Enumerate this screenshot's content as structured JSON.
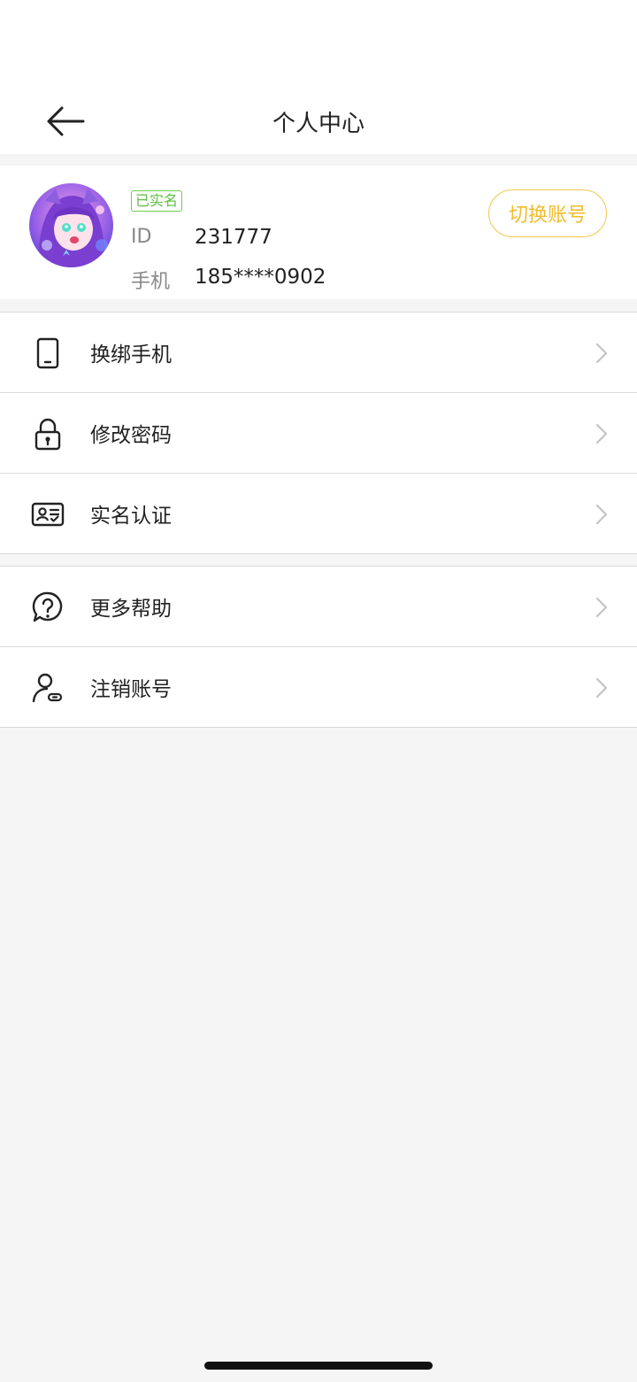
{
  "header": {
    "title": "个人中心",
    "back_icon": "arrow-left-icon"
  },
  "profile": {
    "verified_badge": "已实名",
    "id_label": "ID",
    "id_value": "231777",
    "phone_label": "手机",
    "phone_value": "185****0902",
    "switch_account_label": "切换账号",
    "accent_color": "#f0bc2a",
    "verified_color": "#5cbf3e"
  },
  "menu_group_1": [
    {
      "label": "换绑手机",
      "icon": "phone-icon"
    },
    {
      "label": "修改密码",
      "icon": "lock-icon"
    },
    {
      "label": "实名认证",
      "icon": "id-card-icon"
    }
  ],
  "menu_group_2": [
    {
      "label": "更多帮助",
      "icon": "help-icon"
    },
    {
      "label": "注销账号",
      "icon": "user-cancel-icon"
    }
  ]
}
